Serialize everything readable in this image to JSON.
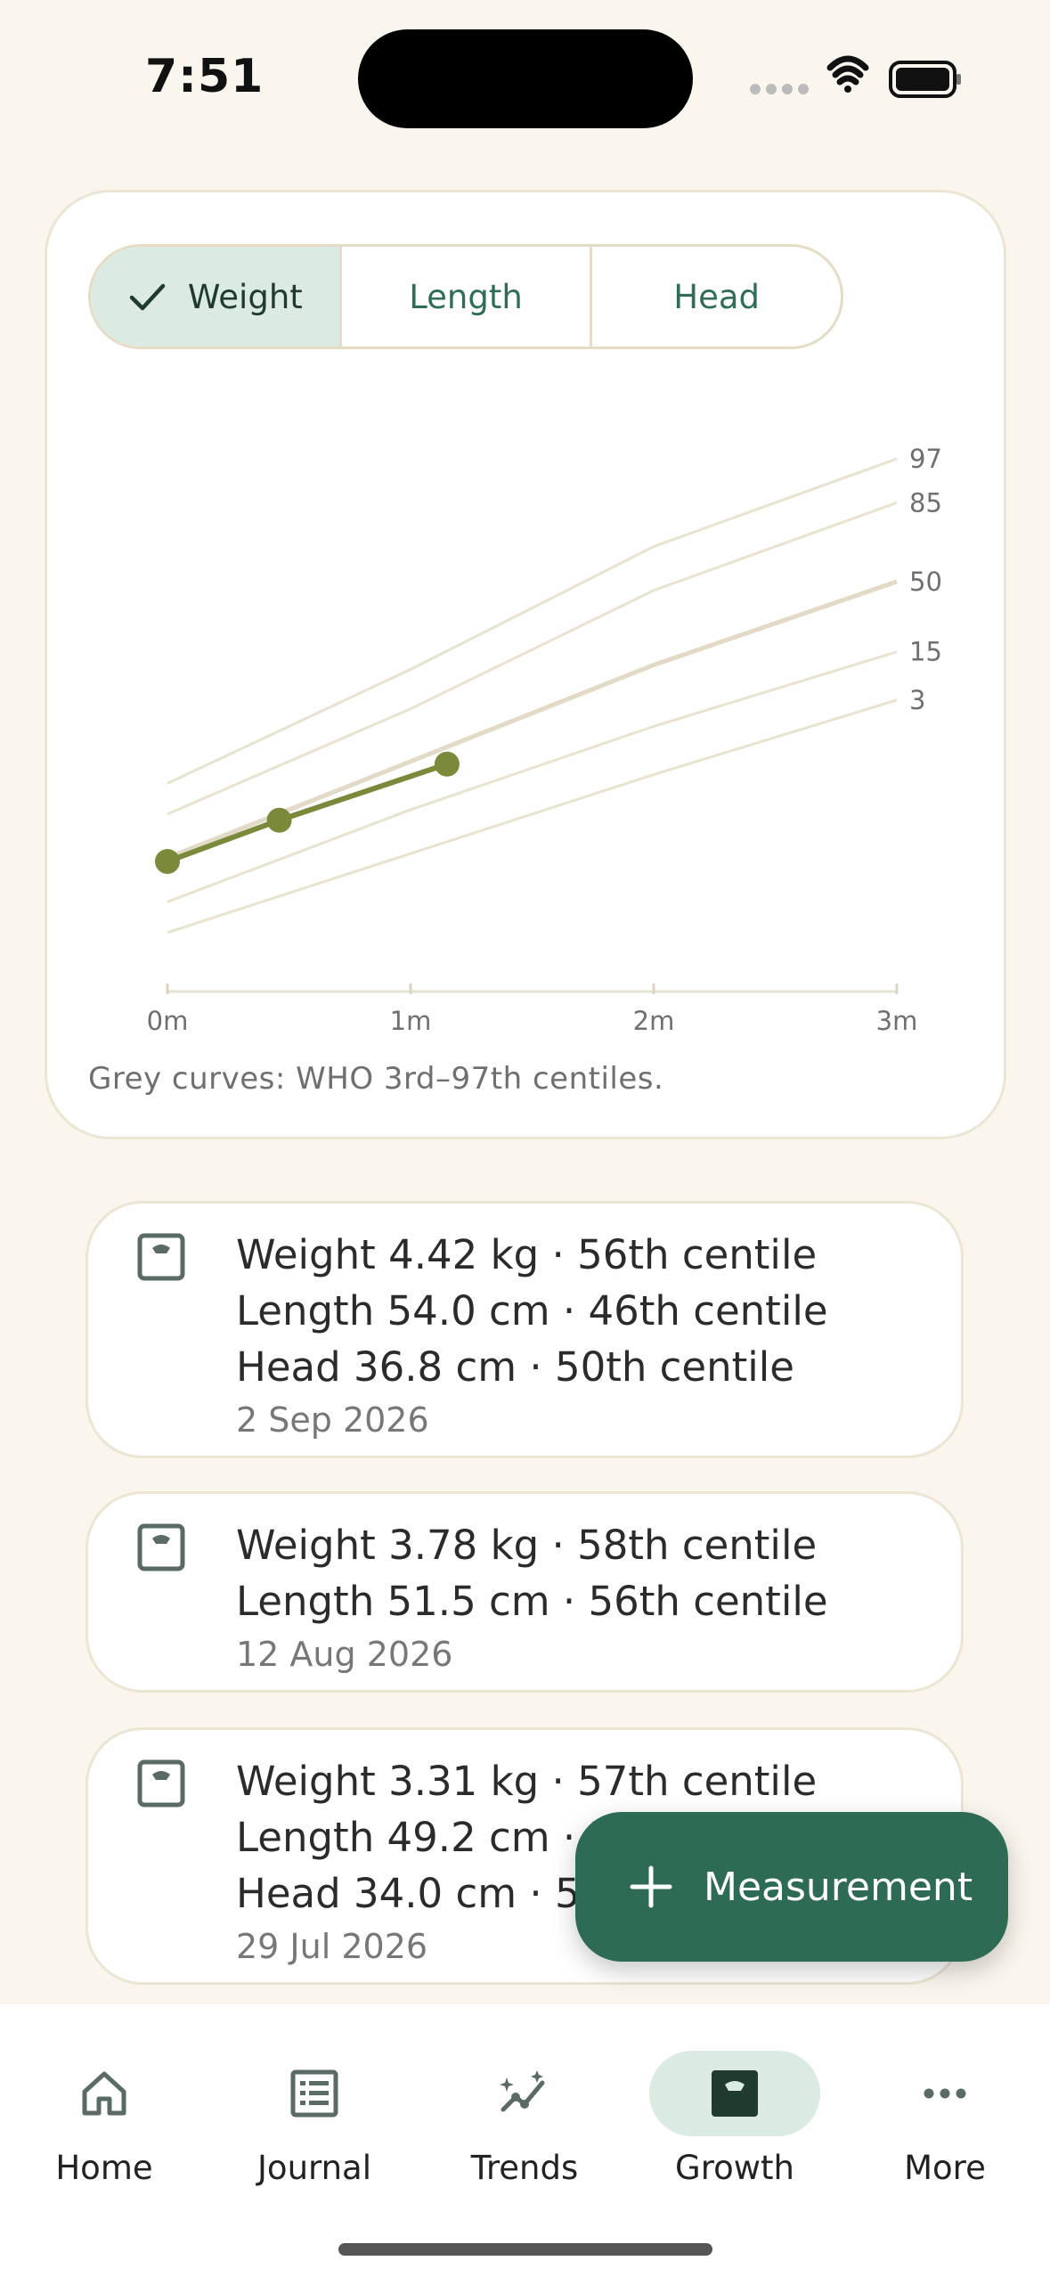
{
  "status_bar": {
    "time": "7:51"
  },
  "tabs": [
    {
      "label": "Weight",
      "active": true
    },
    {
      "label": "Length",
      "active": false
    },
    {
      "label": "Head",
      "active": false
    }
  ],
  "chart_data": {
    "type": "line",
    "x_ticks": [
      "0m",
      "1m",
      "2m",
      "3m"
    ],
    "xlim": [
      0,
      3
    ],
    "centiles": [
      {
        "name": "97",
        "values": [
          4.2,
          5.5,
          6.9,
          7.9
        ]
      },
      {
        "name": "85",
        "values": [
          3.85,
          5.05,
          6.4,
          7.4
        ]
      },
      {
        "name": "50",
        "values": [
          3.35,
          4.45,
          5.55,
          6.5
        ]
      },
      {
        "name": "15",
        "values": [
          2.85,
          3.9,
          4.85,
          5.7
        ]
      },
      {
        "name": "3",
        "values": [
          2.5,
          3.4,
          4.3,
          5.15
        ]
      }
    ],
    "centile_x": [
      0,
      1,
      2,
      3
    ],
    "measurements": [
      {
        "x": 0.0,
        "y": 3.31
      },
      {
        "x": 0.46,
        "y": 3.78
      },
      {
        "x": 1.15,
        "y": 4.42
      }
    ],
    "ylim": [
      2.0,
      8.5
    ],
    "colors": {
      "centile": "#e9e2cf",
      "median": "#e2d9c6",
      "series": "#7a8a3a"
    }
  },
  "chart_caption": "Grey curves: WHO 3rd–97th centiles.",
  "entries": [
    {
      "lines": [
        "Weight 4.42 kg · 56th centile",
        "Length 54.0 cm · 46th centile",
        "Head 36.8 cm · 50th centile"
      ],
      "date": "2 Sep 2026"
    },
    {
      "lines": [
        "Weight 3.78 kg · 58th centile",
        "Length 51.5 cm · 56th centile"
      ],
      "date": "12 Aug 2026"
    },
    {
      "lines": [
        "Weight 3.31 kg · 57th centile",
        "Length 49.2 cm · 51",
        "Head 34.0 cm · 54"
      ],
      "date": "29 Jul 2026"
    }
  ],
  "fab": {
    "label": "Measurement",
    "icon": "plus-icon"
  },
  "nav": [
    {
      "label": "Home",
      "icon": "home-icon",
      "active": false
    },
    {
      "label": "Journal",
      "icon": "journal-icon",
      "active": false
    },
    {
      "label": "Trends",
      "icon": "trends-icon",
      "active": false
    },
    {
      "label": "Growth",
      "icon": "growth-icon",
      "active": true
    },
    {
      "label": "More",
      "icon": "more-icon",
      "active": false
    }
  ],
  "colors": {
    "accent": "#2e6b55",
    "background": "#faf6ee",
    "active_tint": "#dbebe2"
  }
}
